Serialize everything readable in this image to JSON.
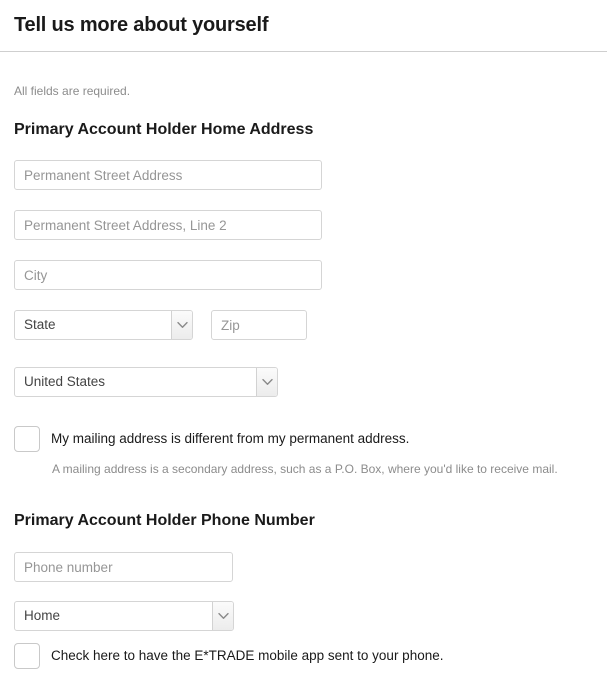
{
  "header": {
    "title": "Tell us more about yourself"
  },
  "intro": {
    "required_note": "All fields are required."
  },
  "address_section": {
    "heading": "Primary Account Holder Home Address",
    "street1_placeholder": "Permanent Street Address",
    "street2_placeholder": "Permanent Street Address, Line 2",
    "city_placeholder": "City",
    "state_value": "State",
    "zip_placeholder": "Zip",
    "country_value": "United States",
    "mailing_checkbox_label": "My mailing address is different from my permanent address.",
    "mailing_help_text": "A mailing address is a secondary address, such as a P.O. Box, where you'd like to receive mail."
  },
  "phone_section": {
    "heading": "Primary Account Holder Phone Number",
    "phone_placeholder": "Phone number",
    "phone_type_value": "Home",
    "mobile_app_checkbox_label": "Check here to have the E*TRADE mobile app sent to your phone."
  },
  "colors": {
    "text": "#1a1a1a",
    "muted": "#8c8c8c",
    "placeholder": "#969696",
    "border": "#d5d5d5",
    "rule": "#cfcfcf"
  }
}
